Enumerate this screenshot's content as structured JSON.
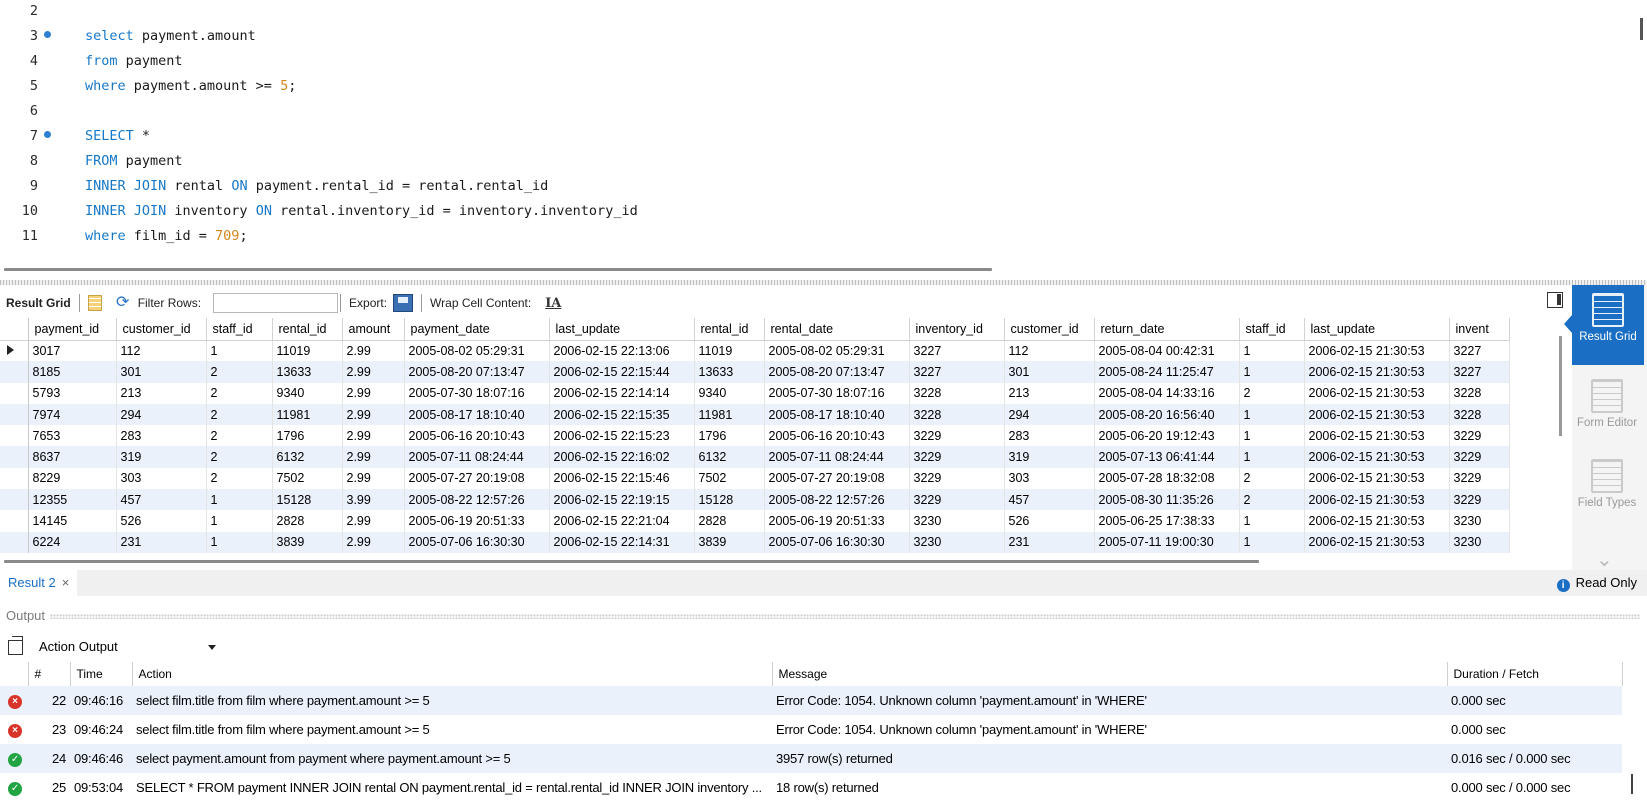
{
  "editor": {
    "lines": [
      {
        "n": "2",
        "dot": false,
        "tokens": []
      },
      {
        "n": "3",
        "dot": true,
        "tokens": [
          {
            "t": "select",
            "c": "kw"
          },
          {
            "t": " payment.amount",
            "c": ""
          }
        ]
      },
      {
        "n": "4",
        "dot": false,
        "tokens": [
          {
            "t": "from",
            "c": "kw"
          },
          {
            "t": " payment",
            "c": ""
          }
        ]
      },
      {
        "n": "5",
        "dot": false,
        "tokens": [
          {
            "t": "where",
            "c": "kw"
          },
          {
            "t": " payment.amount >= ",
            "c": ""
          },
          {
            "t": "5",
            "c": "num"
          },
          {
            "t": ";",
            "c": ""
          }
        ]
      },
      {
        "n": "6",
        "dot": false,
        "tokens": []
      },
      {
        "n": "7",
        "dot": true,
        "tokens": [
          {
            "t": "SELECT",
            "c": "kw"
          },
          {
            "t": " *",
            "c": ""
          }
        ]
      },
      {
        "n": "8",
        "dot": false,
        "tokens": [
          {
            "t": "FROM",
            "c": "kw"
          },
          {
            "t": " payment",
            "c": ""
          }
        ]
      },
      {
        "n": "9",
        "dot": false,
        "tokens": [
          {
            "t": "INNER JOIN",
            "c": "kw"
          },
          {
            "t": " rental ",
            "c": ""
          },
          {
            "t": "ON",
            "c": "kw"
          },
          {
            "t": " payment.rental_id = rental.rental_id",
            "c": ""
          }
        ]
      },
      {
        "n": "10",
        "dot": false,
        "tokens": [
          {
            "t": "INNER JOIN",
            "c": "kw"
          },
          {
            "t": " inventory ",
            "c": ""
          },
          {
            "t": "ON",
            "c": "kw"
          },
          {
            "t": " rental.inventory_id = inventory.inventory_id",
            "c": ""
          }
        ]
      },
      {
        "n": "11",
        "dot": false,
        "tokens": [
          {
            "t": "where",
            "c": "kw"
          },
          {
            "t": " film_id = ",
            "c": ""
          },
          {
            "t": "709",
            "c": "num"
          },
          {
            "t": ";",
            "c": ""
          }
        ]
      }
    ]
  },
  "toolbar": {
    "result_grid": "Result Grid",
    "filter_rows": "Filter Rows:",
    "export": "Export:",
    "wrap": "Wrap Cell Content:"
  },
  "side_panel": {
    "result_grid": "Result Grid",
    "form_editor": "Form Editor",
    "field_types": "Field Types"
  },
  "grid": {
    "columns": [
      "payment_id",
      "customer_id",
      "staff_id",
      "rental_id",
      "amount",
      "payment_date",
      "last_update",
      "rental_id",
      "rental_date",
      "inventory_id",
      "customer_id",
      "return_date",
      "staff_id",
      "last_update",
      "invent"
    ],
    "widths": [
      88,
      90,
      66,
      70,
      62,
      145,
      145,
      70,
      145,
      95,
      90,
      145,
      65,
      145,
      60
    ],
    "rows": [
      [
        "3017",
        "112",
        "1",
        "11019",
        "2.99",
        "2005-08-02 05:29:31",
        "2006-02-15 22:13:06",
        "11019",
        "2005-08-02 05:29:31",
        "3227",
        "112",
        "2005-08-04 00:42:31",
        "1",
        "2006-02-15 21:30:53",
        "3227"
      ],
      [
        "8185",
        "301",
        "2",
        "13633",
        "2.99",
        "2005-08-20 07:13:47",
        "2006-02-15 22:15:44",
        "13633",
        "2005-08-20 07:13:47",
        "3227",
        "301",
        "2005-08-24 11:25:47",
        "1",
        "2006-02-15 21:30:53",
        "3227"
      ],
      [
        "5793",
        "213",
        "2",
        "9340",
        "2.99",
        "2005-07-30 18:07:16",
        "2006-02-15 22:14:14",
        "9340",
        "2005-07-30 18:07:16",
        "3228",
        "213",
        "2005-08-04 14:33:16",
        "2",
        "2006-02-15 21:30:53",
        "3228"
      ],
      [
        "7974",
        "294",
        "2",
        "11981",
        "2.99",
        "2005-08-17 18:10:40",
        "2006-02-15 22:15:35",
        "11981",
        "2005-08-17 18:10:40",
        "3228",
        "294",
        "2005-08-20 16:56:40",
        "1",
        "2006-02-15 21:30:53",
        "3228"
      ],
      [
        "7653",
        "283",
        "2",
        "1796",
        "2.99",
        "2005-06-16 20:10:43",
        "2006-02-15 22:15:23",
        "1796",
        "2005-06-16 20:10:43",
        "3229",
        "283",
        "2005-06-20 19:12:43",
        "1",
        "2006-02-15 21:30:53",
        "3229"
      ],
      [
        "8637",
        "319",
        "2",
        "6132",
        "2.99",
        "2005-07-11 08:24:44",
        "2006-02-15 22:16:02",
        "6132",
        "2005-07-11 08:24:44",
        "3229",
        "319",
        "2005-07-13 06:41:44",
        "1",
        "2006-02-15 21:30:53",
        "3229"
      ],
      [
        "8229",
        "303",
        "2",
        "7502",
        "2.99",
        "2005-07-27 20:19:08",
        "2006-02-15 22:15:46",
        "7502",
        "2005-07-27 20:19:08",
        "3229",
        "303",
        "2005-07-28 18:32:08",
        "2",
        "2006-02-15 21:30:53",
        "3229"
      ],
      [
        "12355",
        "457",
        "1",
        "15128",
        "3.99",
        "2005-08-22 12:57:26",
        "2006-02-15 22:19:15",
        "15128",
        "2005-08-22 12:57:26",
        "3229",
        "457",
        "2005-08-30 11:35:26",
        "2",
        "2006-02-15 21:30:53",
        "3229"
      ],
      [
        "14145",
        "526",
        "1",
        "2828",
        "2.99",
        "2005-06-19 20:51:33",
        "2006-02-15 22:21:04",
        "2828",
        "2005-06-19 20:51:33",
        "3230",
        "526",
        "2005-06-25 17:38:33",
        "1",
        "2006-02-15 21:30:53",
        "3230"
      ],
      [
        "6224",
        "231",
        "1",
        "3839",
        "2.99",
        "2005-07-06 16:30:30",
        "2006-02-15 22:14:31",
        "3839",
        "2005-07-06 16:30:30",
        "3230",
        "231",
        "2005-07-11 19:00:30",
        "1",
        "2006-02-15 21:30:53",
        "3230"
      ]
    ]
  },
  "result_tab": {
    "label": "Result 2",
    "close": "×",
    "read_only": "Read Only",
    "info": "i"
  },
  "output": {
    "title": "Output",
    "selector": "Action Output",
    "columns": [
      "",
      "#",
      "Time",
      "Action",
      "Message",
      "Duration / Fetch"
    ],
    "rows": [
      {
        "status": "error",
        "icon": "×",
        "n": "22",
        "time": "09:46:16",
        "action": "select film.title from film where payment.amount >= 5",
        "message": "Error Code: 1054. Unknown column 'payment.amount' in 'WHERE'",
        "duration": "0.000 sec"
      },
      {
        "status": "error",
        "icon": "×",
        "n": "23",
        "time": "09:46:24",
        "action": "select film.title from film where payment.amount >= 5",
        "message": "Error Code: 1054. Unknown column 'payment.amount' in 'WHERE'",
        "duration": "0.000 sec"
      },
      {
        "status": "ok",
        "icon": "✓",
        "n": "24",
        "time": "09:46:46",
        "action": "select payment.amount from payment where payment.amount >= 5",
        "message": "3957 row(s) returned",
        "duration": "0.016 sec / 0.000 sec"
      },
      {
        "status": "ok",
        "icon": "✓",
        "n": "25",
        "time": "09:53:04",
        "action": "SELECT * FROM payment INNER JOIN rental ON payment.rental_id = rental.rental_id INNER JOIN inventory ...",
        "message": "18 row(s) returned",
        "duration": "0.000 sec / 0.000 sec"
      }
    ]
  },
  "colors": {
    "keyword": "#1778c8",
    "number": "#d4861e",
    "accent": "#1a6fc4",
    "row_alt": "#eaf1fb",
    "error": "#d8342a",
    "ok": "#22a443"
  }
}
